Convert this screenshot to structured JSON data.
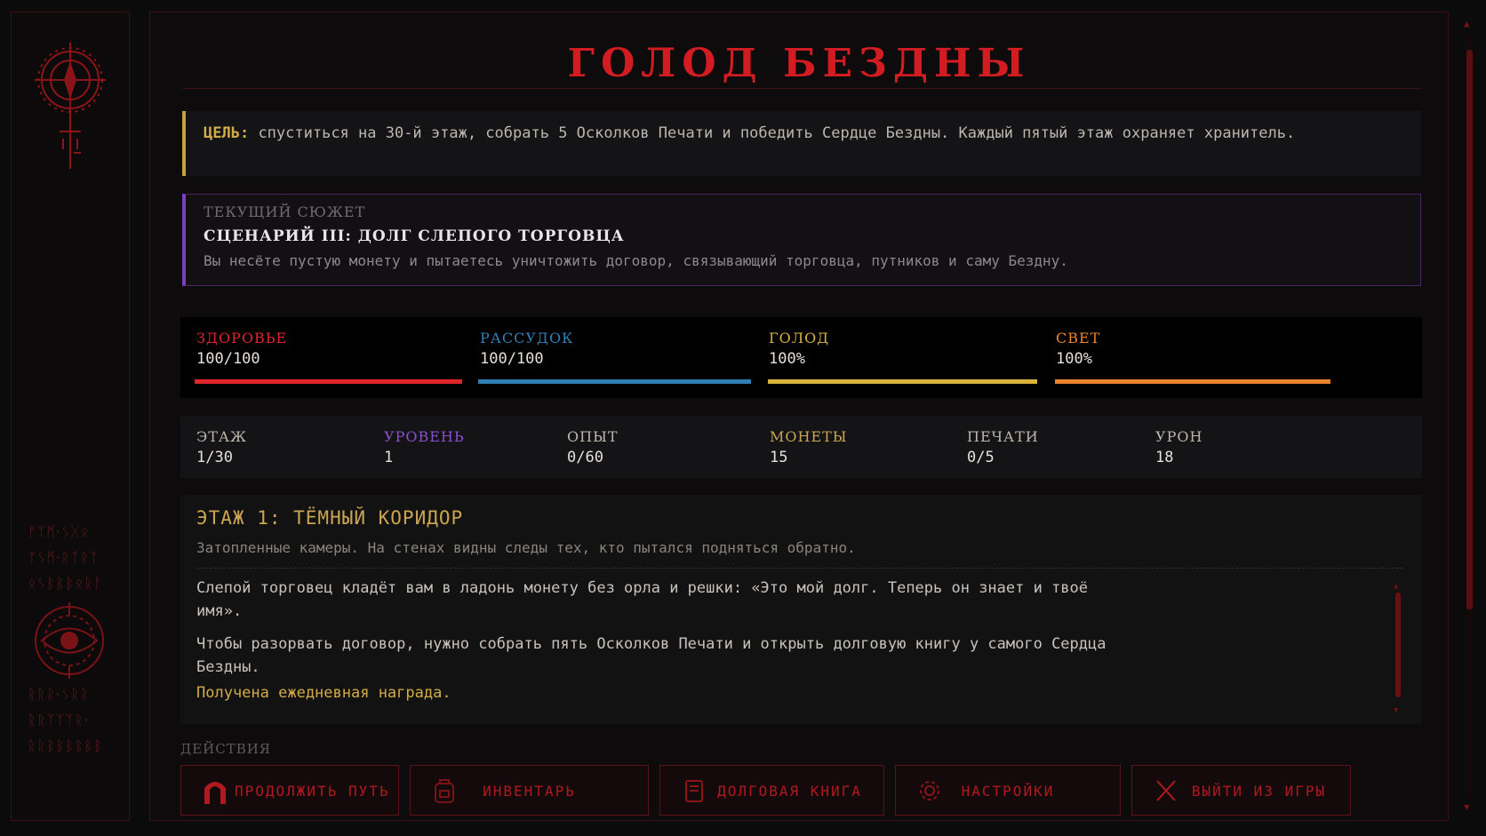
{
  "title": "ГОЛОД БЕЗДНЫ",
  "goal": {
    "label": "ЦЕЛЬ:",
    "text": "спуститься на 30-й этаж, собрать 5 Осколков Печати и победить Сердце Бездны. Каждый пятый этаж охраняет хранитель."
  },
  "story": {
    "label": "ТЕКУЩИЙ СЮЖЕТ",
    "scenario": "СЦЕНАРИЙ III: ДОЛГ СЛЕПОГО ТОРГОВЦА",
    "description": "Вы несёте пустую монету и пытаетесь уничтожить договор, связывающий торговца, путников и саму Бездну."
  },
  "stats": [
    {
      "name": "ЗДОРОВЬЕ",
      "value": "100/100",
      "fill": 1.0,
      "color": "#e0252d"
    },
    {
      "name": "РАССУДОК",
      "value": "100/100",
      "fill": 1.0,
      "color": "#2f7fb5"
    },
    {
      "name": "ГОЛОД",
      "value": "100%",
      "fill": 1.0,
      "color": "#d8b43c"
    },
    {
      "name": "СВЕТ",
      "value": "100%",
      "fill": 1.0,
      "color": "#e8852c"
    }
  ],
  "info": [
    {
      "name": "ЭТАЖ",
      "value": "1/30",
      "color": "#bdb6ae"
    },
    {
      "name": "УРОВЕНЬ",
      "value": "1",
      "color": "#8a4fd0"
    },
    {
      "name": "ОПЫТ",
      "value": "0/60",
      "color": "#bdb6ae"
    },
    {
      "name": "МОНЕТЫ",
      "value": "15",
      "color": "#c9a552"
    },
    {
      "name": "ПЕЧАТИ",
      "value": "0/5",
      "color": "#bdb6ae"
    },
    {
      "name": "УРОН",
      "value": "18",
      "color": "#bdb6ae"
    }
  ],
  "log": {
    "floor_title": "ЭТАЖ 1: ТЁМНЫЙ КОРИДОР",
    "floor_desc": "Затопленные камеры. На стенах видны следы тех, кто пытался подняться обратно.",
    "entries": [
      "Слепой торговец кладёт вам в ладонь монету без орла и решки: «Это мой долг. Теперь он знает и твоё имя».",
      "Чтобы разорвать договор, нужно собрать пять Осколков Печати и открыть долговую книгу у самого Сердца Бездны."
    ],
    "reward": "Получена ежедневная награда."
  },
  "actions_label": "ДЕЙСТВИЯ",
  "buttons": [
    {
      "label": "ПРОДОЛЖИТЬ ПУТЬ",
      "icon": "arch-icon"
    },
    {
      "label": "ИНВЕНТАРЬ",
      "icon": "backpack-icon"
    },
    {
      "label": "ДОЛГОВАЯ КНИГА",
      "icon": "book-icon"
    },
    {
      "label": "НАСТРОЙКИ",
      "icon": "gear-icon"
    },
    {
      "label": "ВЫЙТИ ИЗ ИГРЫ",
      "icon": "close-icon"
    }
  ],
  "sidebar": {
    "runes_top": [
      "ᚠᛉᛗ·ᛊᚷᛟ",
      "ᛉᛊᛗ·ᚱᛏᚱᛉ",
      "ᛟᛊᛒᛒᛒᛟᚱᚨ"
    ],
    "runes_bottom": [
      "ᚱᚱᚱ·ᛊᚱᚱ",
      "ᚱᚱᛉᛉᛉᚱ·",
      "ᚱᚱᛒᛒᛒᛒᛒᛒ"
    ]
  },
  "colors": {
    "accent": "#d21c22",
    "gold": "#d2ac44",
    "purple": "#7d3ec0"
  }
}
